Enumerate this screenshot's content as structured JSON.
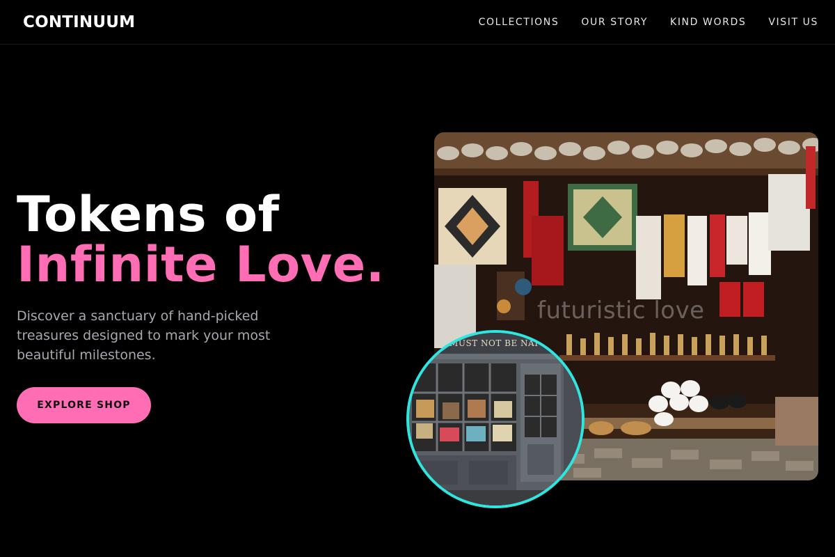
{
  "brand": {
    "name": "CONTINUUM"
  },
  "nav": {
    "items": [
      {
        "label": "COLLECTIONS"
      },
      {
        "label": "OUR STORY"
      },
      {
        "label": "KIND WORDS"
      },
      {
        "label": "VISIT US"
      }
    ]
  },
  "hero": {
    "title_line1": "Tokens of",
    "title_line2": "Infinite Love.",
    "subtitle": "Discover a sanctuary of hand-picked treasures designed to mark your most beautiful milestones.",
    "cta_label": "EXPLORE SHOP"
  },
  "images": {
    "main_watermark": "futuristic love",
    "inset_sign": "IT MUST NOT BE NAI"
  },
  "colors": {
    "background": "#000000",
    "accent_pink": "#ff6eb4",
    "inset_ring": "#2ee6e0",
    "muted_text": "#a8a8b0"
  }
}
